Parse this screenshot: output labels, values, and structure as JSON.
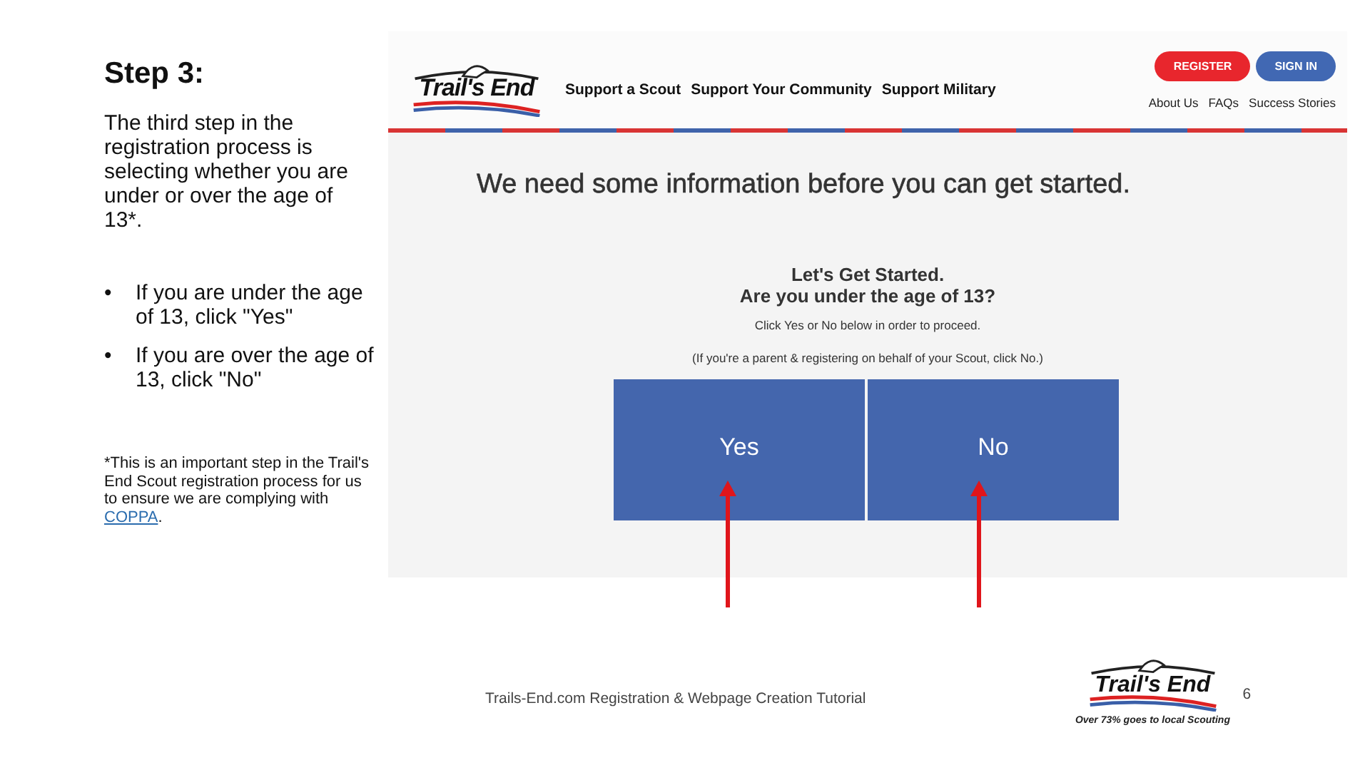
{
  "slide": {
    "title": "Step 3:",
    "intro": "The third step in the registration process is selecting whether you are under or over the age of 13*.",
    "bullets": [
      {
        "marker": "•",
        "text": "If you are under the age of 13, click \"Yes\""
      },
      {
        "marker": "•",
        "text": "If you are over the age of 13, click \"No\""
      }
    ],
    "footnote": {
      "text": "*This is an important step in the Trail's End Scout registration process for us to ensure we are complying with",
      "link": "COPPA",
      "end": "."
    }
  },
  "website": {
    "logo": "Trail's End",
    "nav": [
      {
        "label": "Support a Scout"
      },
      {
        "label": "Support Your Community"
      },
      {
        "label": "Support Military"
      }
    ],
    "buttons": [
      {
        "label": "REGISTER",
        "color": "#e8262d"
      },
      {
        "label": "SIGN IN",
        "color": "#4168b3"
      }
    ],
    "links": [
      {
        "label": "About Us"
      },
      {
        "label": "FAQs"
      },
      {
        "label": "Success Stories"
      }
    ],
    "heading": "We need some information before you can get started.",
    "card": {
      "title": "Let's Get Started.",
      "question": "Are you under the age of 13?",
      "hint": "Click Yes or No below in order to proceed.",
      "note": "(If you're a parent & registering on behalf of your Scout, click No.)",
      "choices": [
        {
          "label": "Yes"
        },
        {
          "label": "No"
        }
      ]
    }
  },
  "footer": {
    "text": "Trails-End.com Registration & Webpage Creation Tutorial",
    "logo": "Trail's End",
    "tagline": "Over 73% goes to local Scouting",
    "page": "6"
  }
}
